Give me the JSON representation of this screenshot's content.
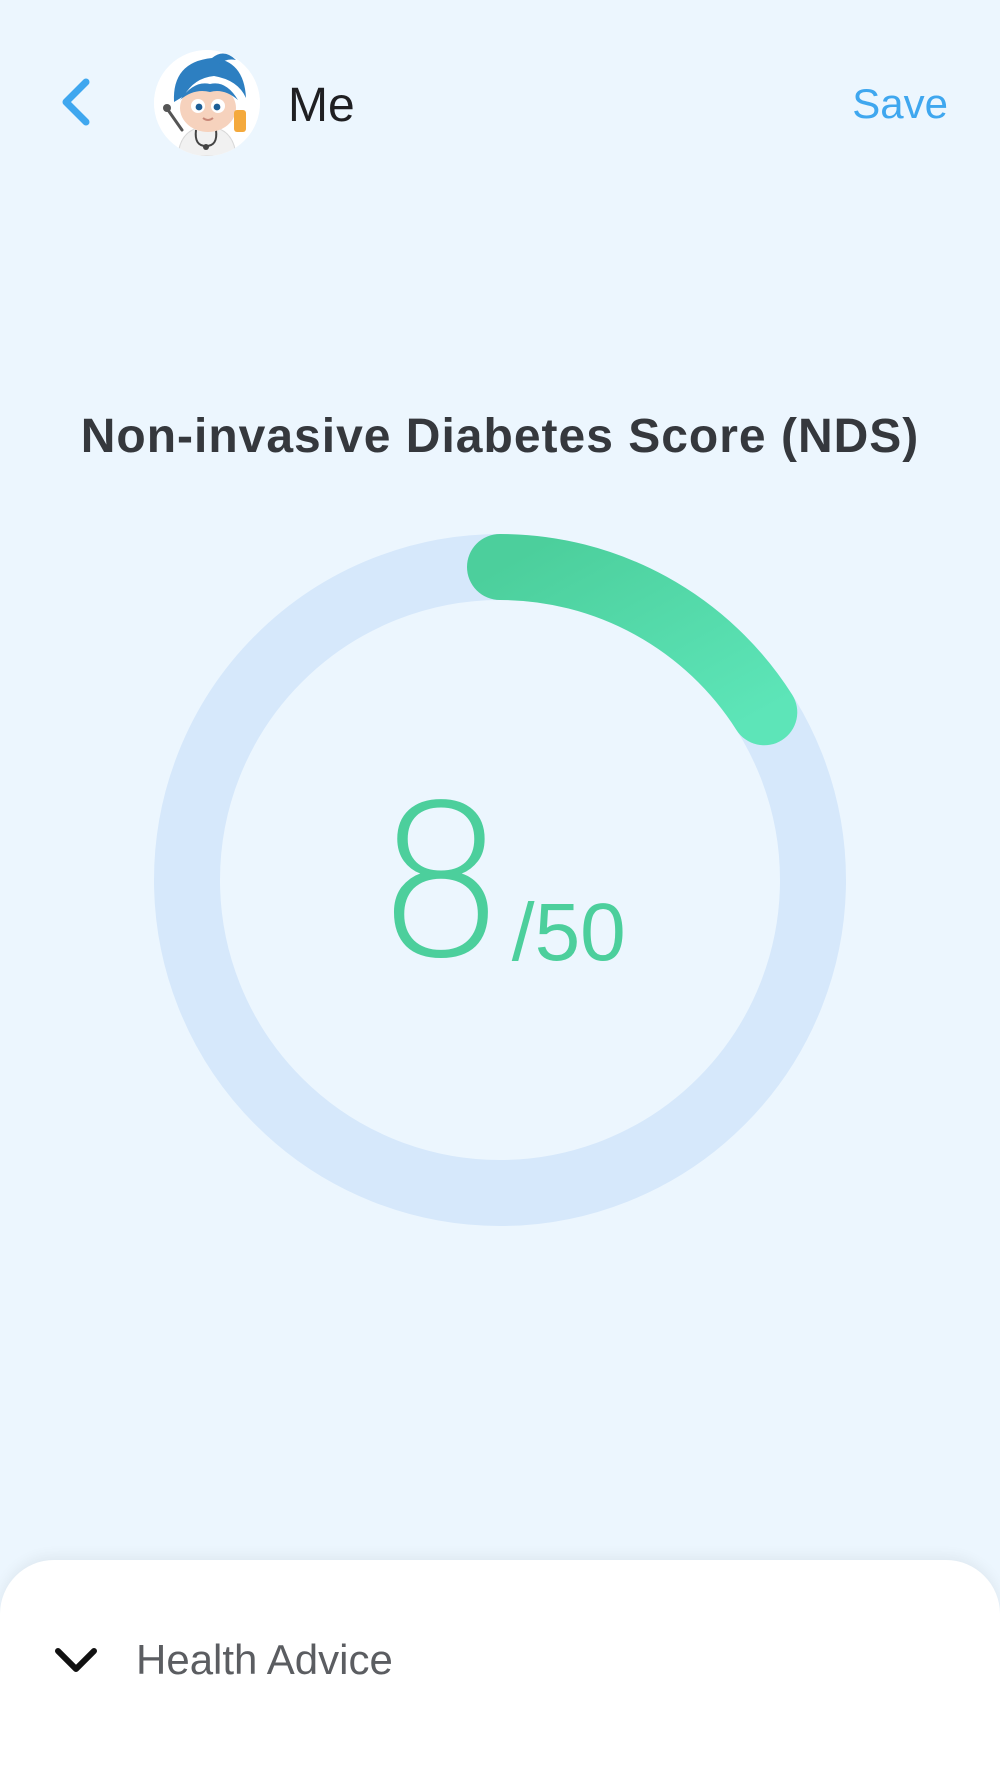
{
  "header": {
    "back_icon": "chevron-left-icon",
    "avatar_icon": "doctor-avatar-icon",
    "name": "Me",
    "save_label": "Save"
  },
  "score": {
    "title": "Non-invasive Diabetes Score (NDS)",
    "value": "8",
    "max": "/50",
    "progress_fraction": 0.16,
    "colors": {
      "track": "#d6e8fb",
      "arc_start": "#4ccf9c",
      "arc_end": "#5de5b8",
      "text": "#4ccf9c"
    }
  },
  "sheet": {
    "toggle_icon": "chevron-down-icon",
    "title": "Health Advice"
  },
  "colors": {
    "background": "#ecf6fe",
    "accent": "#3fa7ef"
  }
}
